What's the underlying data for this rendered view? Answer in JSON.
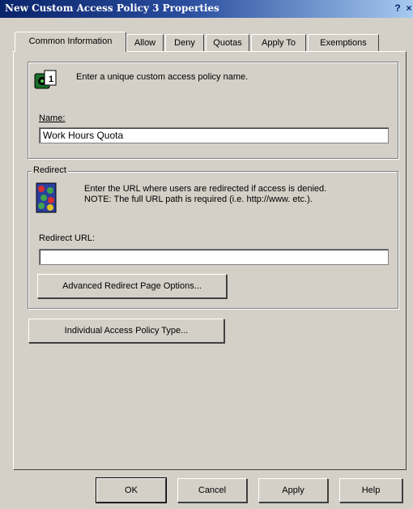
{
  "window": {
    "title": "New Custom Access Policy 3 Properties",
    "help_glyph": "?",
    "close_glyph": "×"
  },
  "tabs": [
    {
      "label": "Common Information",
      "active": true
    },
    {
      "label": "Allow",
      "active": false
    },
    {
      "label": "Deny",
      "active": false
    },
    {
      "label": "Quotas",
      "active": false
    },
    {
      "label": "Apply To",
      "active": false
    },
    {
      "label": "Exemptions",
      "active": false
    }
  ],
  "name_group": {
    "instruction": "Enter a unique custom access policy name.",
    "name_label": "Name:",
    "name_value": "Work Hours Quota"
  },
  "redirect_group": {
    "label": "Redirect",
    "instruction_line1": "Enter the URL where users are redirected if access is denied.",
    "instruction_line2": "NOTE: The full URL path is required (i.e. http://www. etc.).",
    "url_label": "Redirect URL:",
    "url_value": "",
    "advanced_button": "Advanced Redirect Page Options..."
  },
  "individual_button": "Individual Access Policy Type...",
  "footer": {
    "ok": "OK",
    "cancel": "Cancel",
    "apply": "Apply",
    "help": "Help"
  }
}
